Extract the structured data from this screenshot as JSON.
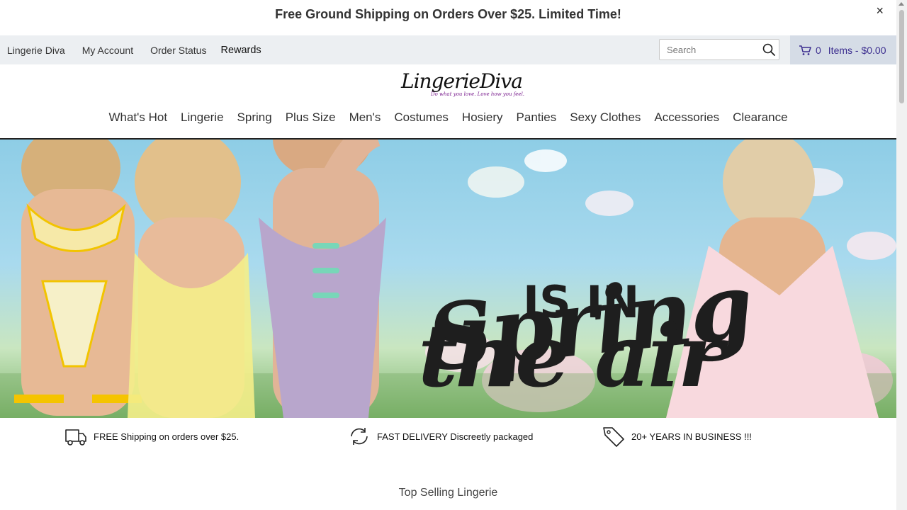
{
  "promo": {
    "text": "Free Ground Shipping on Orders Over $25. Limited Time!",
    "close": "×"
  },
  "utility": {
    "links": [
      "Lingerie Diva",
      "My Account",
      "Order Status",
      "Rewards"
    ],
    "search_placeholder": "Search",
    "cart_count": "0",
    "cart_text": "Items - $0.00"
  },
  "logo": {
    "name": "LingerieDiva",
    "tagline": "Do what you love. Love how you feel."
  },
  "nav": [
    "What's Hot",
    "Lingerie",
    "Spring",
    "Plus Size",
    "Men's",
    "Costumes",
    "Hosiery",
    "Panties",
    "Sexy Clothes",
    "Accessories",
    "Clearance"
  ],
  "hero": {
    "line1": "Spring",
    "line2": "IS IN",
    "line3": "the air"
  },
  "features": [
    {
      "icon": "delivery-truck-icon",
      "text": "FREE Shipping on orders over $25."
    },
    {
      "icon": "refresh-arrows-icon",
      "text": "FAST DELIVERY Discreetly packaged"
    },
    {
      "icon": "price-tag-icon",
      "text": "20+ YEARS IN BUSINESS !!!"
    }
  ],
  "section_title": "Top Selling Lingerie",
  "colors": {
    "cart_text": "#3b2d8f",
    "util_bg": "#eceff2",
    "cart_bg": "#d5dce6",
    "tagline": "#7a1e8e"
  }
}
